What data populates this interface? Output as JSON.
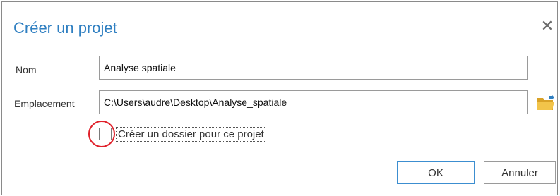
{
  "dialog": {
    "title": "Créer un projet",
    "close_icon": "close-icon"
  },
  "form": {
    "name_label": "Nom",
    "name_value": "Analyse spatiale",
    "location_label": "Emplacement",
    "location_value": "C:\\Users\\audre\\Desktop\\Analyse_spatiale",
    "browse_icon": "folder-icon",
    "create_folder_label": "Créer un dossier pour ce projet",
    "create_folder_checked": false
  },
  "buttons": {
    "ok_label": "OK",
    "cancel_label": "Annuler"
  },
  "colors": {
    "title": "#2f7fc1",
    "highlight_circle": "#e0202a",
    "folder": "#e8b431"
  }
}
